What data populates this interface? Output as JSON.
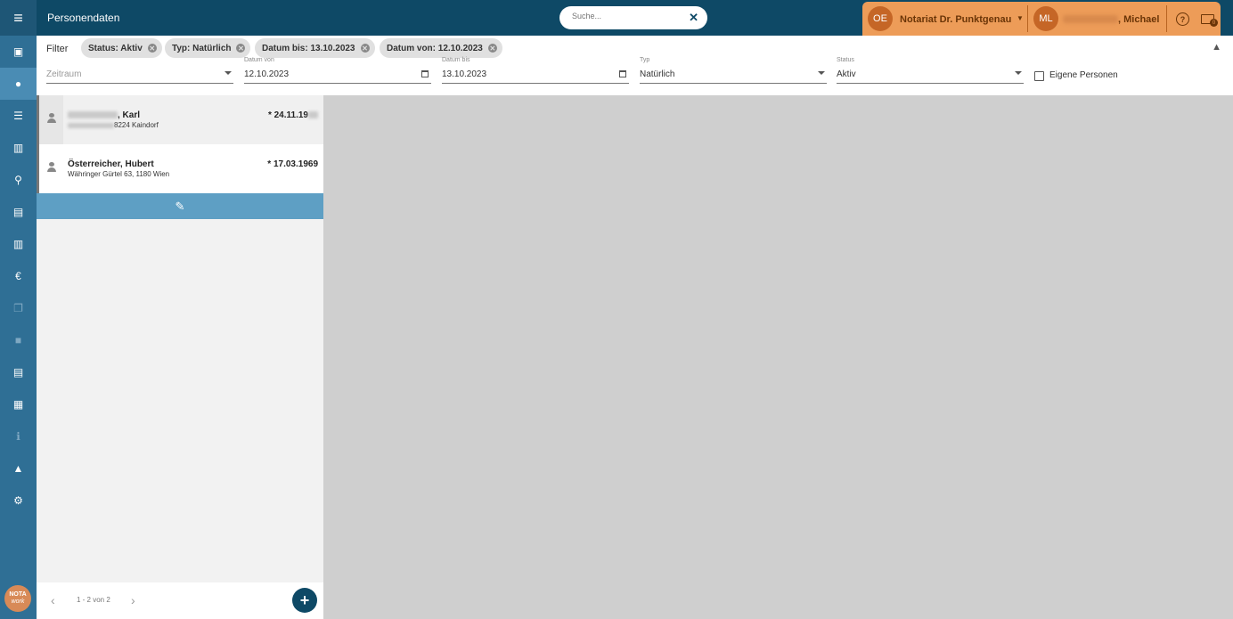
{
  "sidebar": {
    "menu_icon": "hamburger-menu-icon",
    "items": [
      {
        "name": "calendar-check-icon",
        "glyph": "▣",
        "active": false,
        "dim": false
      },
      {
        "name": "person-icon",
        "glyph": "●",
        "active": true,
        "dim": false
      },
      {
        "name": "list-icon",
        "glyph": "☰",
        "active": false,
        "dim": false
      },
      {
        "name": "books-icon",
        "glyph": "▥",
        "active": false,
        "dim": false
      },
      {
        "name": "seal-icon",
        "glyph": "⚲",
        "active": false,
        "dim": false
      },
      {
        "name": "document-icon",
        "glyph": "▤",
        "active": false,
        "dim": false
      },
      {
        "name": "bank-icon",
        "glyph": "▥",
        "active": false,
        "dim": false
      },
      {
        "name": "euro-icon",
        "glyph": "€",
        "active": false,
        "dim": false
      },
      {
        "name": "copy-icon",
        "glyph": "❐",
        "active": false,
        "dim": true
      },
      {
        "name": "square-icon",
        "glyph": "■",
        "active": false,
        "dim": true
      },
      {
        "name": "file-icon",
        "glyph": "▤",
        "active": false,
        "dim": false
      },
      {
        "name": "newspaper-icon",
        "glyph": "▦",
        "active": false,
        "dim": false
      },
      {
        "name": "info-icon",
        "glyph": "ℹ",
        "active": false,
        "dim": true
      },
      {
        "name": "chart-icon",
        "glyph": "▲",
        "active": false,
        "dim": false
      },
      {
        "name": "settings-icon",
        "glyph": "⚙",
        "active": false,
        "dim": false
      }
    ],
    "logo_line1": "NOTA",
    "logo_line2": "work"
  },
  "header": {
    "title": "Personendaten",
    "search_placeholder": "Suche...",
    "org_initials": "OE",
    "org_name": "Notariat Dr. Punktgenau",
    "user_initials": "ML",
    "user_name": ", Michael",
    "mail_count": "0"
  },
  "filter": {
    "label": "Filter",
    "chips": [
      "Status: Aktiv",
      "Typ: Natürlich",
      "Datum bis: 13.10.2023",
      "Datum von: 12.10.2023"
    ],
    "zeitraum_placeholder": "Zeitraum",
    "datum_von_label": "Datum von",
    "datum_von_value": "12.10.2023",
    "datum_bis_label": "Datum bis",
    "datum_bis_value": "13.10.2023",
    "typ_label": "Typ",
    "typ_value": "Natürlich",
    "status_label": "Status",
    "status_value": "Aktiv",
    "eigene_label": "Eigene Personen"
  },
  "persons": [
    {
      "name": ", Karl",
      "address": "8224 Kaindorf",
      "date": "* 24.11.19",
      "selected": true
    },
    {
      "name": "Österreicher, Hubert",
      "address": "Währinger Gürtel 63, 1180 Wien",
      "date": "* 17.03.1969",
      "selected": false
    }
  ],
  "pager": {
    "info": "1 - 2 von 2"
  },
  "colors": {
    "header": "#0e4966",
    "sidebar": "#2f6f95",
    "accent": "#ed9c58",
    "edit_bar": "#5e9fc4"
  }
}
